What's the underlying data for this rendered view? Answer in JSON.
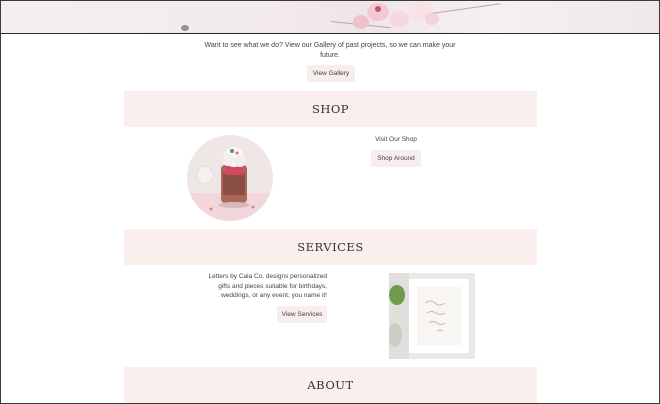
{
  "gallery": {
    "text": "Want to see what we do? View our Gallery of past projects, so we can make your future.",
    "button": "View Gallery"
  },
  "shop": {
    "title": "SHOP",
    "caption": "Visit Our Shop",
    "button": "Shop Around"
  },
  "services": {
    "title": "SERVICES",
    "text": "Letters by Cala Co. designs personalized gifts and pieces suitable for birthdays, weddings, or any event; you name it!",
    "button": "View Services"
  },
  "about": {
    "title": "ABOUT"
  },
  "colors": {
    "band": "#fbefed",
    "button": "#f8eeee",
    "frame_border": "#3a3a3a"
  },
  "images": {
    "hero": "cherry-blossom-banner",
    "shop": "hot-chocolate-jar-photo",
    "services": "framed-lettering-photo"
  }
}
